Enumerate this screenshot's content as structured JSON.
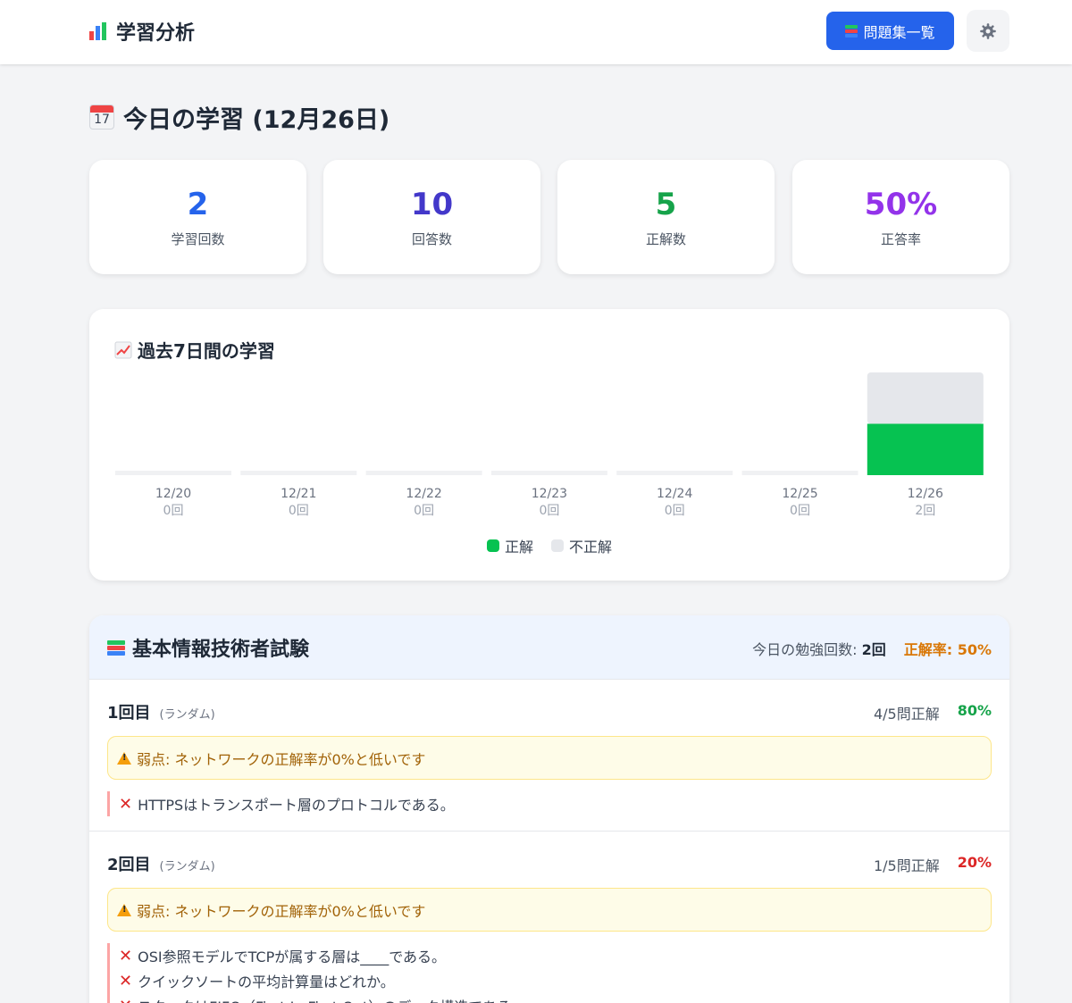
{
  "header": {
    "title": "学習分析",
    "problems_button": "問題集一覧"
  },
  "today": {
    "title": "今日の学習 (12月26日)",
    "calendar_day": "17",
    "stats": [
      {
        "value": "2",
        "label": "学習回数",
        "color": "#2563eb"
      },
      {
        "value": "10",
        "label": "回答数",
        "color": "#4338ca"
      },
      {
        "value": "5",
        "label": "正解数",
        "color": "#16a34a"
      },
      {
        "value": "50%",
        "label": "正答率",
        "color": "#9333ea"
      }
    ]
  },
  "chart": {
    "title": "過去7日間の学習",
    "legend_correct": "正解",
    "legend_incorrect": "不正解"
  },
  "chart_data": {
    "type": "bar",
    "categories": [
      "12/20",
      "12/21",
      "12/22",
      "12/23",
      "12/24",
      "12/25",
      "12/26"
    ],
    "count_labels": [
      "0回",
      "0回",
      "0回",
      "0回",
      "0回",
      "0回",
      "2回"
    ],
    "series": [
      {
        "name": "正解",
        "values": [
          0,
          0,
          0,
          0,
          0,
          0,
          5
        ],
        "color": "#06c251"
      },
      {
        "name": "不正解",
        "values": [
          0,
          0,
          0,
          0,
          0,
          0,
          5
        ],
        "color": "#e5e7eb"
      }
    ],
    "stacked": true,
    "legend": "bottom-center"
  },
  "exam": {
    "title": "基本情報技術者試験",
    "study_count_label": "今日の勉強回数:",
    "study_count_value": "2回",
    "rate_label": "正解率: 50%",
    "sessions": [
      {
        "title": "1回目",
        "mode": "(ランダム)",
        "score": "4/5問正解",
        "pct": "80%",
        "pct_color": "#16a34a",
        "warning": "弱点: ネットワークの正解率が0%と低いです",
        "wrong": [
          "HTTPSはトランスポート層のプロトコルである。"
        ]
      },
      {
        "title": "2回目",
        "mode": "(ランダム)",
        "score": "1/5問正解",
        "pct": "20%",
        "pct_color": "#dc2626",
        "warning": "弱点: ネットワークの正解率が0%と低いです",
        "wrong": [
          "OSI参照モデルでTCPが属する層は____である。",
          "クイックソートの平均計算量はどれか。",
          "スタックはFIFO（First In First Out）のデータ構造である。"
        ]
      }
    ]
  }
}
